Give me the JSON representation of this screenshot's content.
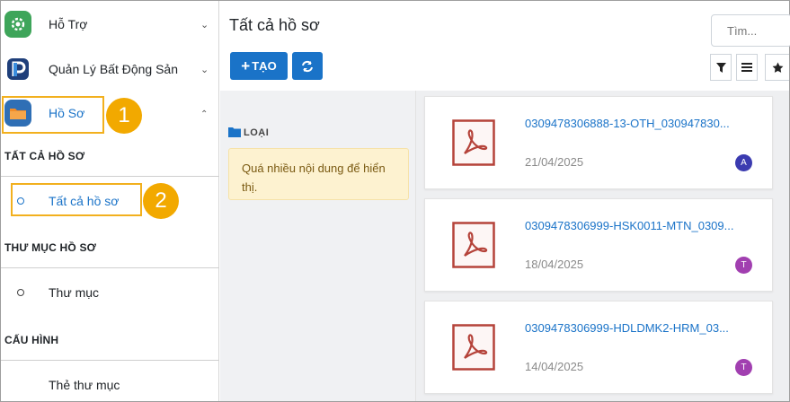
{
  "sidebar": {
    "apps": [
      {
        "label": "Hỗ Trợ",
        "icon": "support-gear-icon",
        "chevron": "down"
      },
      {
        "label": "Quản Lý Bất Động Sản",
        "icon": "real-estate-logo-icon",
        "chevron": "down"
      },
      {
        "label": "Hồ Sơ",
        "icon": "folder-app-icon",
        "chevron": "up"
      }
    ],
    "sections": [
      {
        "title": "TẤT CẢ HỒ SƠ",
        "items": [
          "Tất cả hồ sơ"
        ]
      },
      {
        "title": "THƯ MỤC HỒ SƠ",
        "items": [
          "Thư mục"
        ]
      },
      {
        "title": "CẤU HÌNH",
        "items": [
          "Thẻ thư mục"
        ]
      }
    ],
    "steps": [
      "1",
      "2"
    ]
  },
  "header": {
    "title": "Tất cả hồ sơ",
    "create_label": "TẠO",
    "search_placeholder": "Tìm..."
  },
  "filter_panel": {
    "category_label": "LOẠI",
    "warning": "Quá nhiều nội dung để hiển thị."
  },
  "documents": [
    {
      "name": "0309478306888-13-OTH_030947830...",
      "date": "21/04/2025",
      "owner": "A",
      "owner_color": "#3b3bb0"
    },
    {
      "name": "0309478306999-HSK0011-MTN_0309...",
      "date": "18/04/2025",
      "owner": "T",
      "owner_color": "#a13fb0"
    },
    {
      "name": "0309478306999-HDLDMK2-HRM_03...",
      "date": "14/04/2025",
      "owner": "T",
      "owner_color": "#a13fb0"
    }
  ],
  "colors": {
    "accent": "#1a73c8",
    "highlight": "#f2b01e",
    "warning_bg": "#fdf2d0",
    "pdf_red": "#b5433a"
  }
}
